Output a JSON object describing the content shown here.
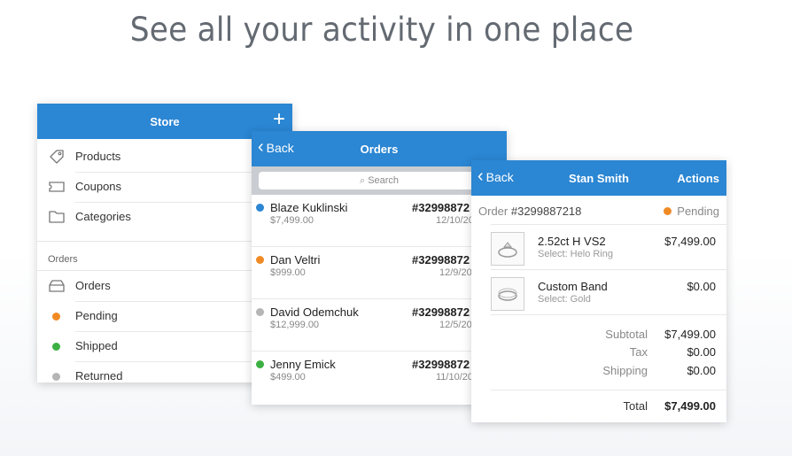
{
  "headline": "See all your activity in one place",
  "store": {
    "title": "Store",
    "add_label": "+",
    "items": [
      {
        "label": "Products",
        "icon": "tag-icon"
      },
      {
        "label": "Coupons",
        "icon": "coupon-icon"
      },
      {
        "label": "Categories",
        "icon": "folder-icon"
      }
    ],
    "orders_section": "Orders",
    "order_items": [
      {
        "label": "Orders",
        "icon": "inbox-icon"
      },
      {
        "label": "Pending",
        "color": "#f08a24"
      },
      {
        "label": "Shipped",
        "color": "#3cb043"
      },
      {
        "label": "Returned",
        "color": "#b5b5b5"
      }
    ]
  },
  "orders": {
    "back_label": "Back",
    "title": "Orders",
    "search_placeholder": "Search",
    "rows": [
      {
        "name": "Blaze Kuklinski",
        "amount": "$7,499.00",
        "number": "#32998872",
        "date": "12/10/20",
        "color": "#2b86d3"
      },
      {
        "name": "Dan Veltri",
        "amount": "$999.00",
        "number": "#32998872",
        "date": "12/9/20",
        "color": "#f08a24"
      },
      {
        "name": "David Odemchuk",
        "amount": "$12,999.00",
        "number": "#32998872",
        "date": "12/5/20",
        "color": "#b5b5b5"
      },
      {
        "name": "Jenny Emick",
        "amount": "$499.00",
        "number": "#32998872",
        "date": "11/10/20",
        "color": "#3cb043"
      }
    ]
  },
  "detail": {
    "back_label": "Back",
    "title": "Stan Smith",
    "actions_label": "Actions",
    "order_prefix": "Order",
    "order_number": "#3299887218",
    "status": "Pending",
    "status_color": "#f08a24",
    "items": [
      {
        "name": "2.52ct H VS2",
        "sub": "Select: Helo Ring",
        "price": "$7,499.00"
      },
      {
        "name": "Custom Band",
        "sub": "Select: Gold",
        "price": "$0.00"
      }
    ],
    "subtotal_label": "Subtotal",
    "subtotal": "$7,499.00",
    "tax_label": "Tax",
    "tax": "$0.00",
    "shipping_label": "Shipping",
    "shipping": "$0.00",
    "total_label": "Total",
    "total": "$7,499.00"
  }
}
